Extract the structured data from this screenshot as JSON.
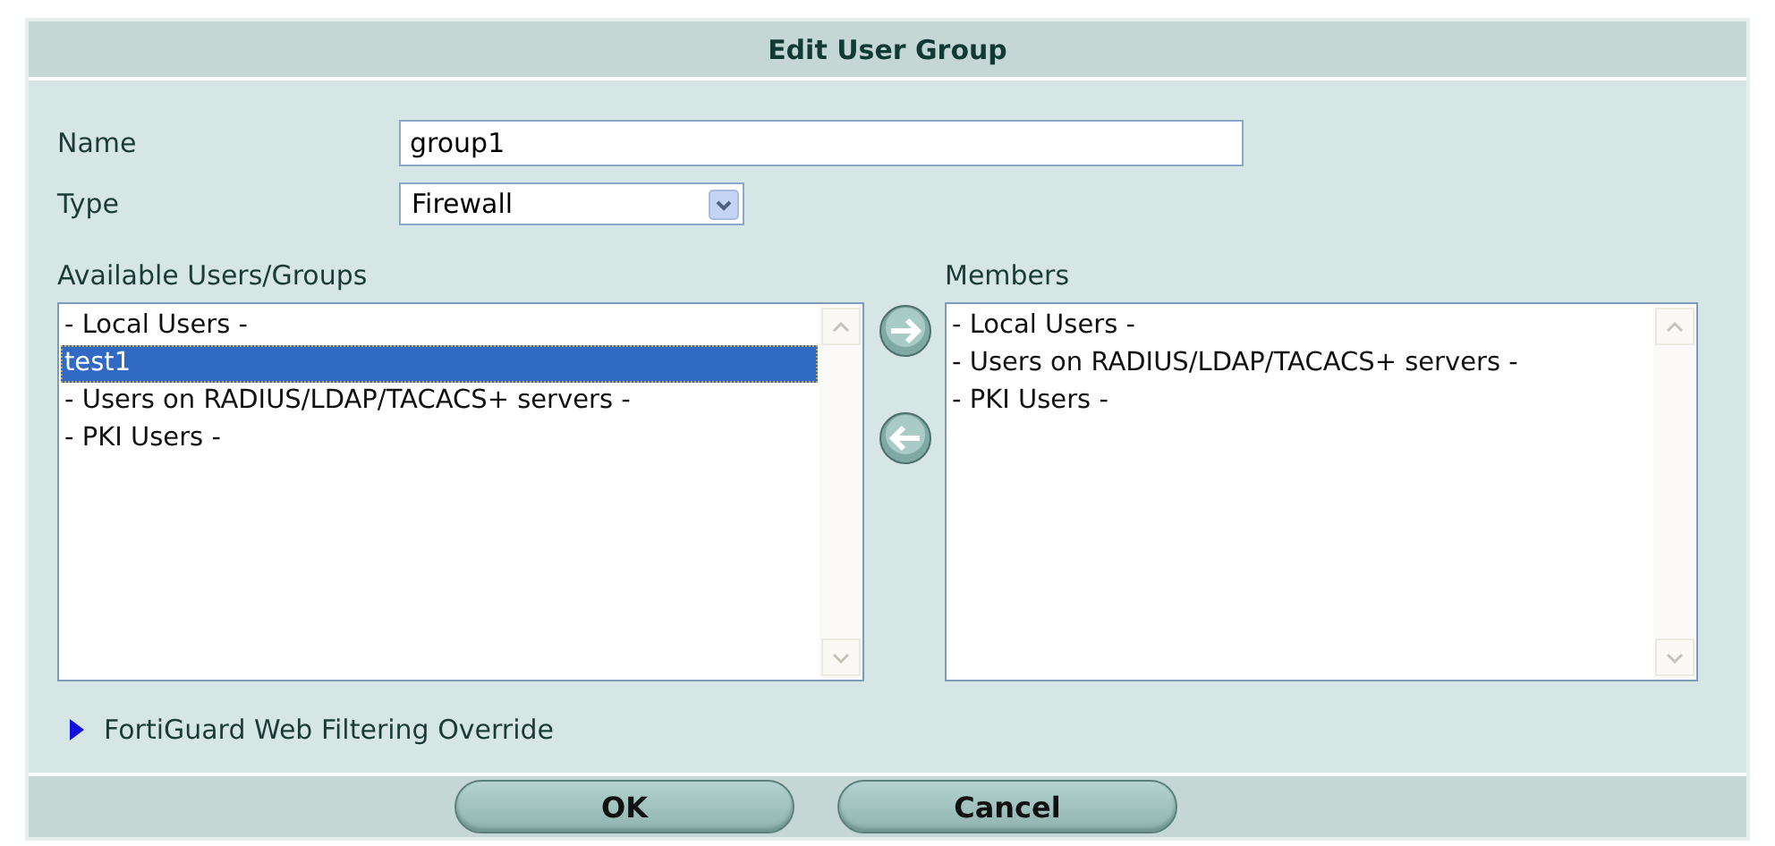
{
  "title": "Edit User Group",
  "fields": [
    {
      "label": "Name",
      "kind": "text",
      "value": "group1"
    },
    {
      "label": "Type",
      "kind": "select",
      "value": "Firewall"
    }
  ],
  "available": {
    "label": "Available Users/Groups",
    "items": [
      {
        "text": "- Local Users -",
        "selected": false
      },
      {
        "text": "test1",
        "selected": true
      },
      {
        "text": "- Users on RADIUS/LDAP/TACACS+ servers -",
        "selected": false
      },
      {
        "text": "- PKI Users -",
        "selected": false
      }
    ]
  },
  "members": {
    "label": "Members",
    "items": [
      {
        "text": "- Local Users -",
        "selected": false
      },
      {
        "text": "- Users on RADIUS/LDAP/TACACS+ servers -",
        "selected": false
      },
      {
        "text": "- PKI Users -",
        "selected": false
      }
    ]
  },
  "override": {
    "label": "FortiGuard Web Filtering Override",
    "expanded": false
  },
  "buttons": [
    "OK",
    "Cancel"
  ]
}
